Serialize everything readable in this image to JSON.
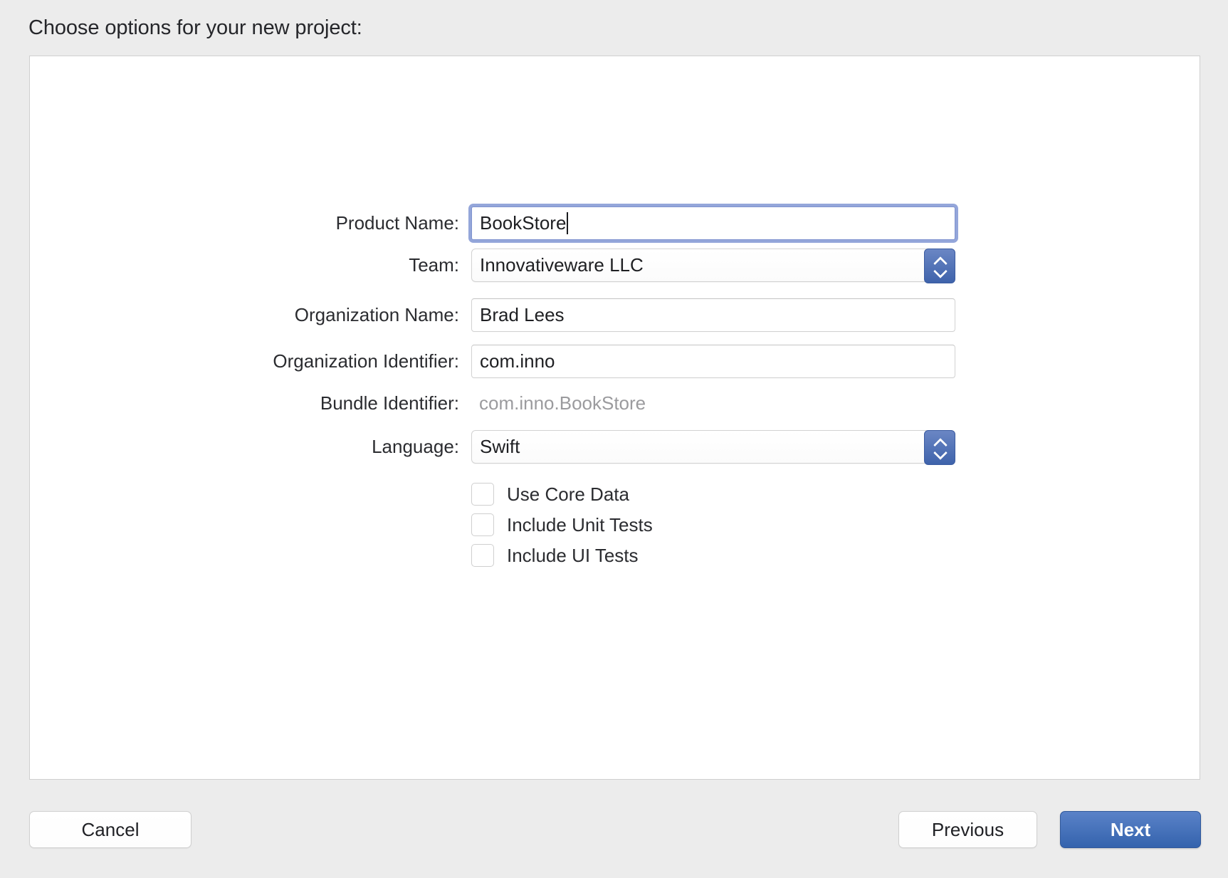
{
  "sheet": {
    "title": "Choose options for your new project:"
  },
  "form": {
    "fields": [
      {
        "label": "Product Name:",
        "type": "textfield",
        "value": "BookStore",
        "focused": true
      },
      {
        "label": "Team:",
        "type": "popup",
        "value": "Innovativeware LLC"
      },
      {
        "label": "Organization Name:",
        "type": "textfield",
        "value": "Brad Lees",
        "focused": false
      },
      {
        "label": "Organization Identifier:",
        "type": "textfield",
        "value": "com.inno",
        "focused": false
      },
      {
        "label": "Bundle Identifier:",
        "type": "static",
        "value": "com.inno.BookStore"
      },
      {
        "label": "Language:",
        "type": "popup",
        "value": "Swift"
      }
    ],
    "checkboxes": [
      {
        "label": "Use Core Data",
        "checked": false
      },
      {
        "label": "Include Unit Tests",
        "checked": false
      },
      {
        "label": "Include UI Tests",
        "checked": false
      }
    ]
  },
  "footer": {
    "cancel_label": "Cancel",
    "previous_label": "Previous",
    "next_label": "Next"
  },
  "colors": {
    "accent": "#3463ad",
    "focus_ring": "#8196d3",
    "window_background": "#ececec",
    "panel_background": "#ffffff",
    "static_text": "#9b9b9e"
  }
}
